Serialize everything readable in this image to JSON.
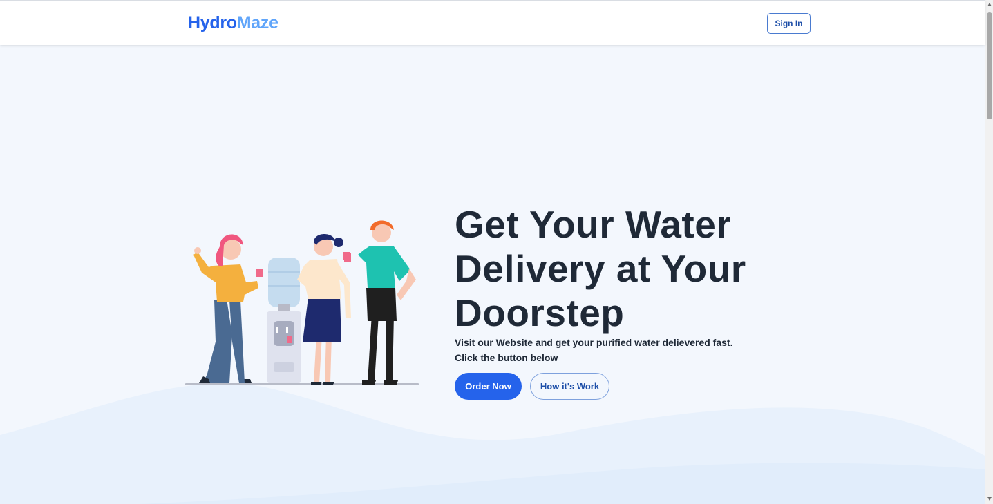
{
  "header": {
    "logo_part1": "Hydro",
    "logo_part2": "Maze",
    "signin_label": "Sign In"
  },
  "hero": {
    "title": "Get Your Water Delivery at Your Doorstep",
    "subtitle_line1": "Visit our Website and get your purified water delievered fast.",
    "subtitle_line2": "Click the button below",
    "order_label": "Order Now",
    "how_label": "How it's Work",
    "illustration": "people-at-water-cooler-illustration"
  },
  "colors": {
    "primary": "#2563eb",
    "logo_light": "#60a5fa",
    "background": "#f3f7fd",
    "text_dark": "#1f2937"
  }
}
